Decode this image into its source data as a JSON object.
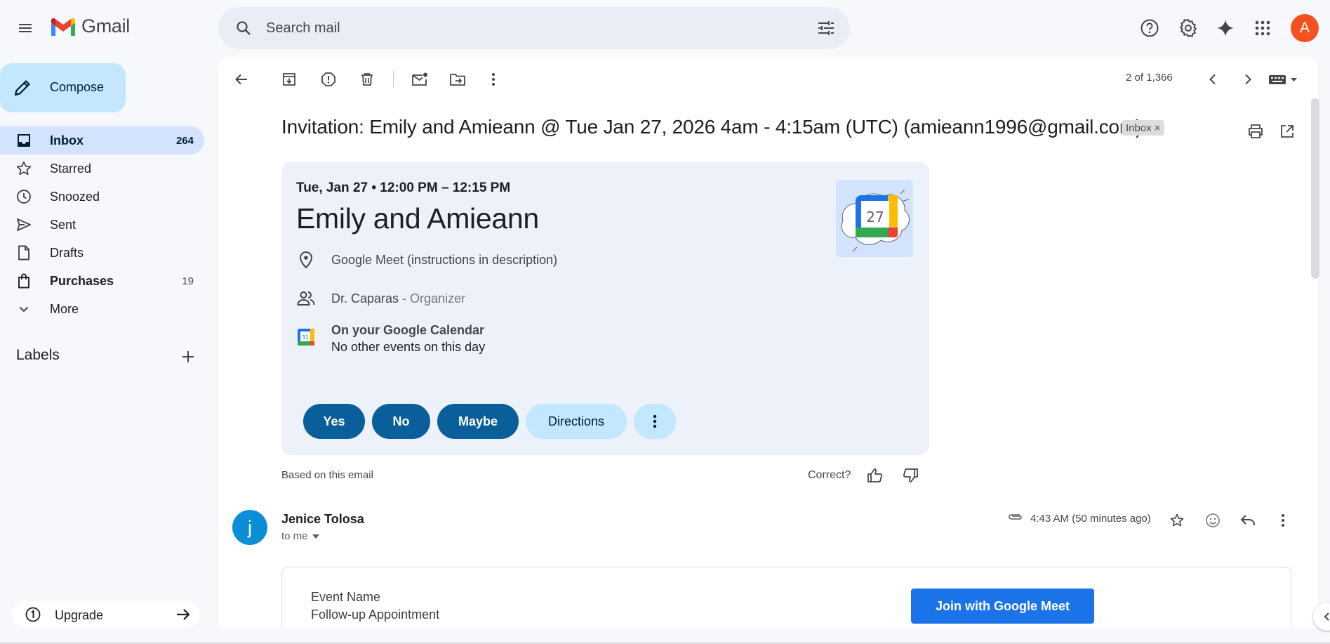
{
  "app": {
    "name": "Gmail"
  },
  "search": {
    "placeholder": "Search mail"
  },
  "avatar": {
    "initial": "A",
    "color": "#f4511e"
  },
  "compose": {
    "label": "Compose"
  },
  "sidebar": {
    "items": [
      {
        "label": "Inbox",
        "count": "264",
        "icon": "inbox-icon",
        "active": true
      },
      {
        "label": "Starred",
        "count": "",
        "icon": "star-icon"
      },
      {
        "label": "Snoozed",
        "count": "",
        "icon": "clock-icon"
      },
      {
        "label": "Sent",
        "count": "",
        "icon": "send-icon"
      },
      {
        "label": "Drafts",
        "count": "",
        "icon": "draft-icon"
      },
      {
        "label": "Purchases",
        "count": "19",
        "icon": "shopping-bag-icon",
        "bold": true
      },
      {
        "label": "More",
        "count": "",
        "icon": "chevron-down-icon"
      }
    ],
    "labels_heading": "Labels",
    "upgrade": "Upgrade"
  },
  "toolbar": {
    "pager": "2 of 1,366"
  },
  "email": {
    "subject": "Invitation: Emily and Amieann @ Tue Jan 27, 2026 4am - 4:15am (UTC) (amieann1996@gmail.com)",
    "chip": "Inbox",
    "chip_close": "×"
  },
  "invite": {
    "date": "Tue, Jan 27 • 12:00 PM – 12:15 PM",
    "title": "Emily and Amieann",
    "calendar_day": "27",
    "location": "Google Meet (instructions in description)",
    "organizer_name": "Dr. Caparas",
    "organizer_role": " - Organizer",
    "calendar_heading": "On your Google Calendar",
    "calendar_note": "No other events on this day",
    "calendar_icon_day": "31",
    "buttons": {
      "yes": "Yes",
      "no": "No",
      "maybe": "Maybe",
      "directions": "Directions"
    },
    "based": "Based on this email",
    "correct": "Correct?"
  },
  "message": {
    "sender_initial": "j",
    "sender": "Jenice Tolosa",
    "to": "to me",
    "time": "4:43 AM (50 minutes ago)"
  },
  "body": {
    "event_label": "Event Name",
    "event_value": "Follow-up Appointment",
    "join": "Join with Google Meet"
  },
  "colors": {
    "accent": "#0b57d0",
    "rsvp": "#0a5e99",
    "join": "#1a73e8",
    "inbox_active": "#d3e3fd"
  }
}
